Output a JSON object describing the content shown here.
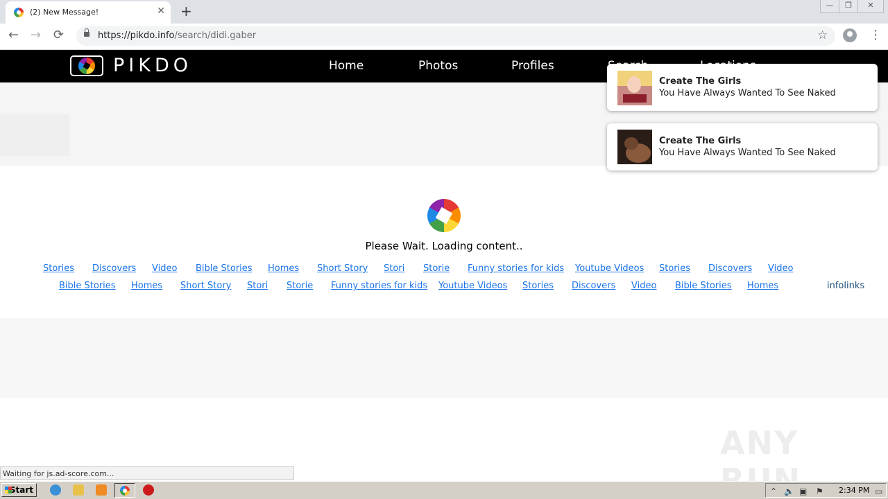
{
  "browser": {
    "tab_title": "(2) New Message!",
    "tab_close": "✕",
    "new_tab": "+",
    "url_host": "https://pikdo.info",
    "url_path": "/search/didi.gaber",
    "back": "←",
    "forward": "→",
    "reload": "⟳",
    "star": "☆",
    "menu": "⋮",
    "win_min": "—",
    "win_max": "❐",
    "win_close": "✕"
  },
  "site": {
    "logo": "PIKDO",
    "nav": [
      "Home",
      "Photos",
      "Profiles",
      "Search",
      "Locations"
    ],
    "loading_text": "Please Wait. Loading content..",
    "links_row1": [
      "Stories",
      "Discovers",
      "Video",
      "Bible Stories",
      "Homes",
      "Short Story",
      "Stori",
      "Storie",
      "Funny stories for kids",
      "Youtube Videos",
      "Stories",
      "Discovers",
      "Video"
    ],
    "links_row2": [
      "Bible Stories",
      "Homes",
      "Short Story",
      "Stori",
      "Storie",
      "Funny stories for kids",
      "Youtube Videos",
      "Stories",
      "Discovers",
      "Video",
      "Bible Stories",
      "Homes"
    ],
    "infolinks": "infolinks"
  },
  "notifications": [
    {
      "title": "Create The Girls",
      "body": "You Have Always Wanted To See Naked"
    },
    {
      "title": "Create The Girls",
      "body": "You Have Always Wanted To See Naked"
    }
  ],
  "status_text": "Waiting for js.ad-score.com...",
  "watermark": "ANY RUN",
  "taskbar": {
    "start_label": "Start",
    "clock": "2:34 PM"
  }
}
